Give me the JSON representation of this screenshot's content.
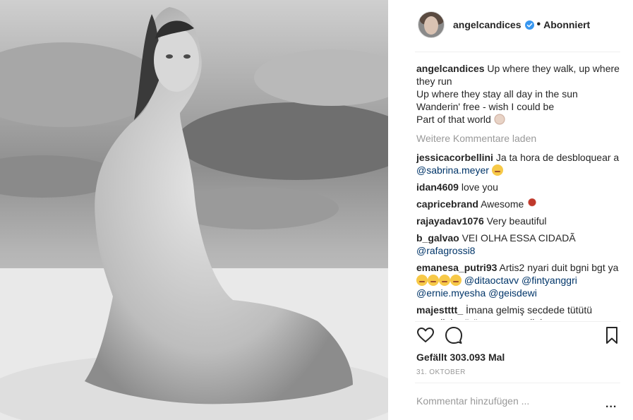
{
  "header": {
    "username": "angelcandices",
    "separator": "•",
    "follow_status": "Abonniert"
  },
  "caption": {
    "username": "angelcandices",
    "lines": [
      "Up where they walk, up where they run",
      "Up where they stay all day in the sun",
      "Wanderin' free - wish I could be",
      "Part of that world"
    ]
  },
  "load_more": "Weitere Kommentare laden",
  "comments": [
    {
      "user": "jessicacorbellini",
      "text": "Ja ta hora de desbloquear a ",
      "mention": "@sabrina.meyer",
      "emoji": "worried-face"
    },
    {
      "user": "idan4609",
      "text": "love you"
    },
    {
      "user": "capricebrand",
      "text": "Awesome",
      "emoji": "rose"
    },
    {
      "user": "rajayadav1076",
      "text": "Very beautiful"
    },
    {
      "user": "b_galvao",
      "text": "VEI OLHA ESSA CIDADÃ ",
      "mention": "@rafagrossi8"
    },
    {
      "user": "emanesa_putri93",
      "text": "Artis2 nyari duit bgni bgt ya ",
      "mentions": [
        "@ditaoctavv",
        "@fintyanggri",
        "@ernie.myesha",
        "@geisdewi"
      ],
      "emoji": "flushed-face"
    },
    {
      "user": "majestttt_",
      "text": "İmana gelmiş secdede tütütü masallah görüvermusun allahın gavurunu"
    }
  ],
  "likes": "Gefällt 303.093 Mal",
  "date": "31. Oktober",
  "comment_placeholder": "Kommentar hinzufügen ...",
  "options": "...",
  "icons": {
    "like": "heart-icon",
    "comment": "comment-bubble-icon",
    "save": "bookmark-icon",
    "verified": "verified-badge-icon"
  },
  "colors": {
    "text": "#262626",
    "muted": "#999999",
    "mention": "#003569",
    "verified": "#3897f0",
    "divider": "#efefef"
  }
}
